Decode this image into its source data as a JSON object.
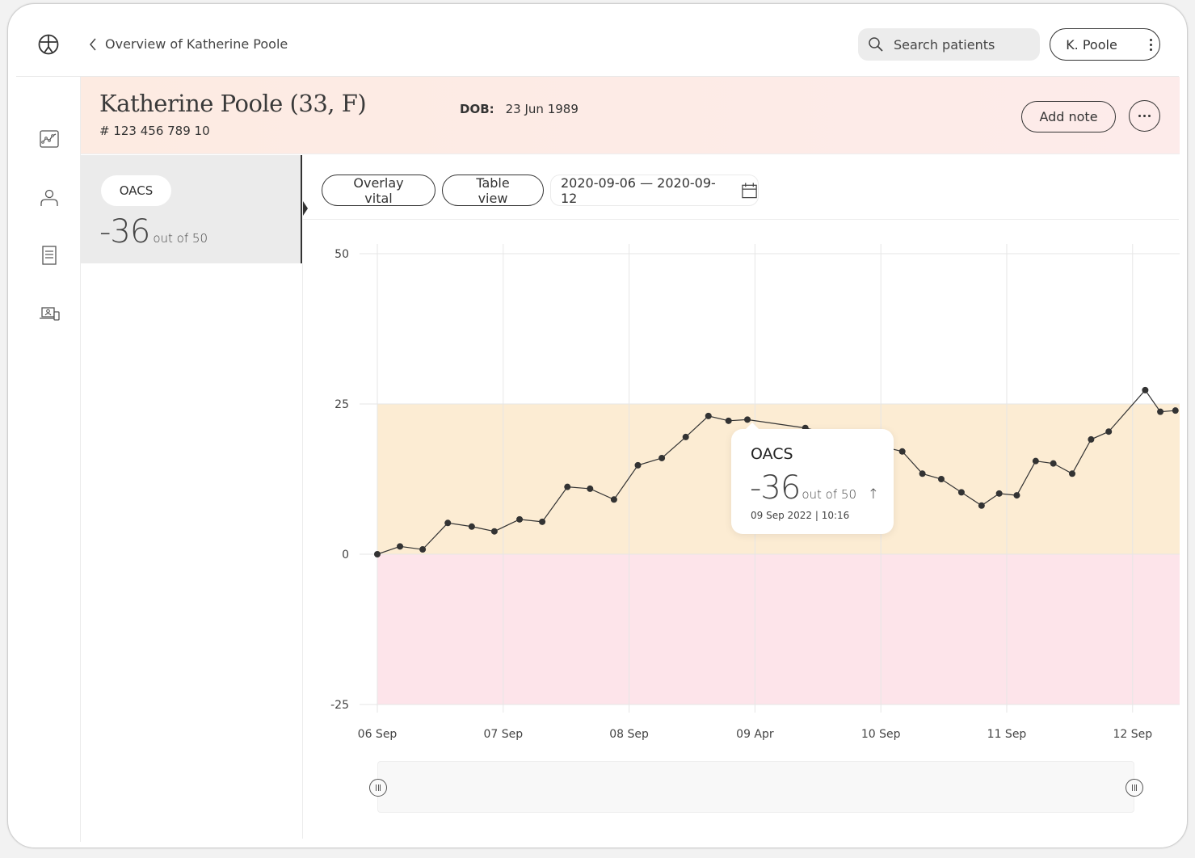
{
  "topbar": {
    "back_label": "Overview of Katherine Poole",
    "search_placeholder": "Search patients",
    "user_label": "K. Poole"
  },
  "sidebar": {
    "items": [
      {
        "icon": "chart-icon",
        "label": "Vitals"
      },
      {
        "icon": "person-icon",
        "label": "Profile"
      },
      {
        "icon": "document-icon",
        "label": "Notes"
      },
      {
        "icon": "devices-icon",
        "label": "Devices"
      }
    ]
  },
  "patient": {
    "name_line": "Katherine Poole (33,  F)",
    "id": "# 123 456 789 10",
    "dob_label": "DOB:",
    "dob_value": "23 Jun 1989",
    "add_note_label": "Add note"
  },
  "vital_card": {
    "name": "OACS",
    "value": "-36",
    "suffix": "out of 50"
  },
  "toolbar": {
    "overlay_label": "Overlay vital",
    "table_label": "Table view",
    "date_range": "2020-09-06 — 2020-09-12"
  },
  "tooltip": {
    "title": "OACS",
    "value": "-36",
    "suffix": "out of 50",
    "trend": "↑",
    "datetime": "09 Sep 2022 | 10:16"
  },
  "colors": {
    "band_warning": "#fcecd3",
    "band_danger": "#fde4ea",
    "line": "#333333",
    "header_bg": "#fdebe4"
  },
  "chart_data": {
    "type": "line",
    "title": "",
    "xlabel": "",
    "ylabel": "",
    "ylim": [
      -25,
      50
    ],
    "yticks": [
      50,
      25,
      0,
      -25
    ],
    "xlim": [
      0,
      6.3
    ],
    "xtick_positions": [
      0,
      1,
      2,
      3,
      4,
      5,
      6
    ],
    "xtick_labels": [
      "06 Sep",
      "07 Sep",
      "08 Sep",
      "09 Apr",
      "10 Sep",
      "11 Sep",
      "12 Sep"
    ],
    "grid": true,
    "bands": [
      {
        "from": 0,
        "to": 25,
        "color": "#fcecd3"
      },
      {
        "from": -25,
        "to": 0,
        "color": "#fde4ea"
      }
    ],
    "series": [
      {
        "name": "OACS",
        "x": [
          0,
          0.18,
          0.36,
          0.56,
          0.75,
          0.93,
          1.13,
          1.31,
          1.51,
          1.69,
          1.88,
          2.07,
          2.26,
          2.45,
          2.63,
          2.79,
          2.94,
          3.4,
          4.17,
          4.33,
          4.48,
          4.64,
          4.8,
          4.94,
          5.08,
          5.23,
          5.37,
          5.52,
          5.67,
          5.81,
          6.1,
          6.22,
          6.34
        ],
        "values": [
          0,
          1.3,
          0.8,
          5.2,
          4.6,
          3.8,
          5.8,
          5.4,
          11.2,
          10.9,
          9.1,
          14.8,
          16.0,
          19.5,
          23.0,
          22.2,
          22.4,
          21.0,
          17.1,
          13.4,
          12.5,
          10.3,
          8.1,
          10.1,
          9.8,
          15.5,
          15.1,
          13.4,
          19.1,
          20.4,
          27.3,
          23.7,
          23.9
        ]
      }
    ],
    "legend": "none"
  }
}
